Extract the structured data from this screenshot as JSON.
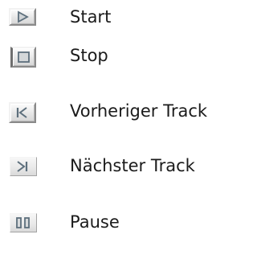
{
  "items": [
    {
      "icon": "play-icon",
      "label": "Start"
    },
    {
      "icon": "stop-icon",
      "label": "Stop"
    },
    {
      "icon": "previous-track-icon",
      "label": "Vorheriger Track"
    },
    {
      "icon": "next-track-icon",
      "label": "Nächster Track"
    },
    {
      "icon": "pause-icon",
      "label": "Pause"
    }
  ],
  "colors": {
    "background": "#ffffff",
    "text": "#1b1b1b",
    "icon_face": "#e6e6e6",
    "icon_glyph": "#5d6f7c"
  }
}
